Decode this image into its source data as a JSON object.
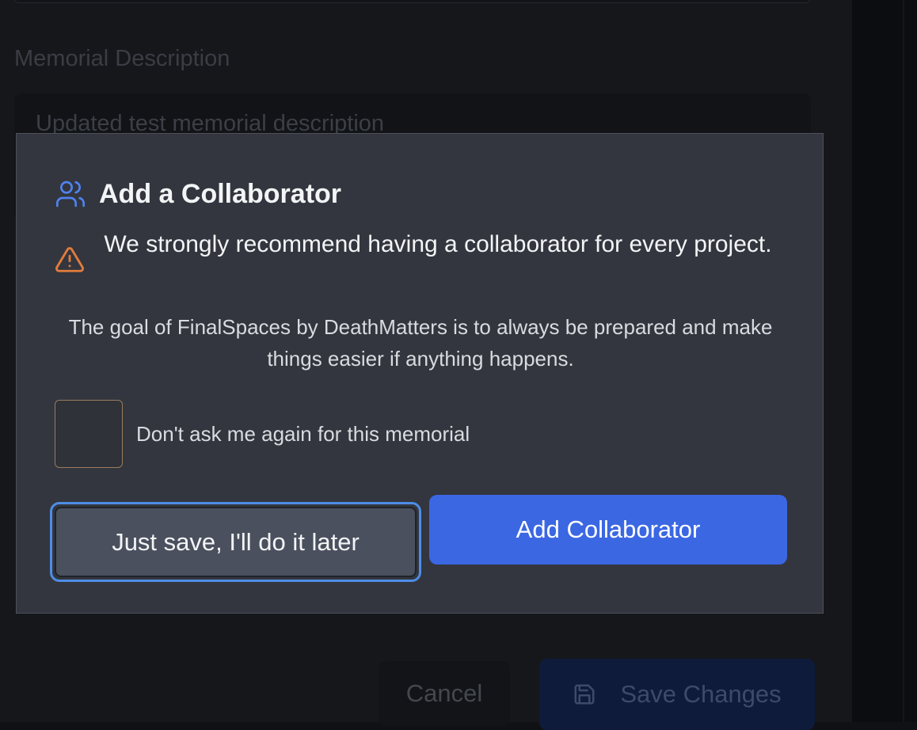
{
  "background": {
    "memorial_description_label": "Memorial Description",
    "memorial_description_value": "Updated test memorial description",
    "cancel_label": "Cancel",
    "save_changes_label": "Save Changes",
    "save_icon": "save-icon"
  },
  "dialog": {
    "title": "Add a Collaborator",
    "title_icon": "users-icon",
    "warning_icon": "warning-icon",
    "warning_text": "We strongly recommend having a collaborator for every project.",
    "goal_text": "The goal of FinalSpaces by DeathMatters is to always be prepared and make things easier if anything happens.",
    "checkbox_label": "Don't ask me again for this memorial",
    "checkbox_checked": false,
    "secondary_button_label": "Just save, I'll do it later",
    "primary_button_label": "Add Collaborator"
  },
  "colors": {
    "primary": "#3b67e3",
    "focus_ring": "#4e8de6",
    "warning": "#e27b3c",
    "dialog_background": "#33363e"
  }
}
